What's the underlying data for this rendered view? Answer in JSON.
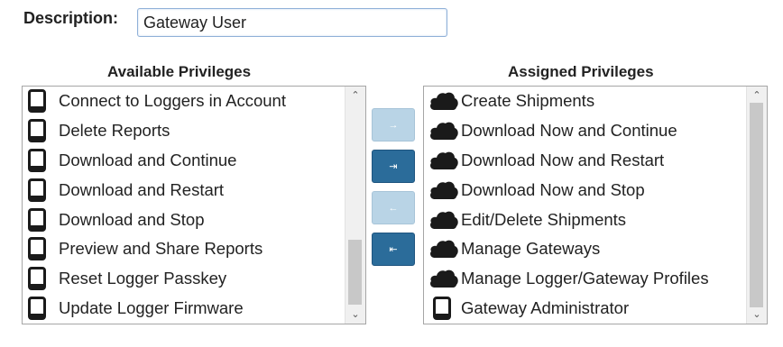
{
  "description": {
    "label": "Description:",
    "value": "Gateway User"
  },
  "available": {
    "title": "Available Privileges",
    "items": [
      {
        "label": "Connect to Loggers in Account",
        "icon": "device-icon"
      },
      {
        "label": "Delete Reports",
        "icon": "device-icon"
      },
      {
        "label": "Download and Continue",
        "icon": "device-icon"
      },
      {
        "label": "Download and Restart",
        "icon": "device-icon"
      },
      {
        "label": "Download and Stop",
        "icon": "device-icon"
      },
      {
        "label": "Preview and Share Reports",
        "icon": "device-icon"
      },
      {
        "label": "Reset Logger Passkey",
        "icon": "device-icon"
      },
      {
        "label": "Update Logger Firmware",
        "icon": "device-icon"
      }
    ],
    "scroll": {
      "up": "⌃",
      "down": "⌄"
    }
  },
  "assigned": {
    "title": "Assigned Privileges",
    "items": [
      {
        "label": "Create Shipments",
        "icon": "cloud-icon"
      },
      {
        "label": "Download Now and Continue",
        "icon": "cloud-icon"
      },
      {
        "label": "Download Now and Restart",
        "icon": "cloud-icon"
      },
      {
        "label": "Download Now and Stop",
        "icon": "cloud-icon"
      },
      {
        "label": "Edit/Delete Shipments",
        "icon": "cloud-icon"
      },
      {
        "label": "Manage Gateways",
        "icon": "cloud-icon"
      },
      {
        "label": "Manage Logger/Gateway Profiles",
        "icon": "cloud-icon"
      },
      {
        "label": "Gateway Administrator",
        "icon": "device-icon"
      }
    ],
    "scroll": {
      "up": "⌃",
      "down": "⌄"
    }
  },
  "buttons": {
    "move_right": {
      "glyph": "→",
      "enabled": false
    },
    "move_all_right": {
      "glyph": "⇥",
      "enabled": true
    },
    "move_left": {
      "glyph": "←",
      "enabled": false
    },
    "move_all_left": {
      "glyph": "⇤",
      "enabled": true
    }
  },
  "colors": {
    "active_button": "#2b6c9a",
    "disabled_button": "#b9d4e6",
    "input_border": "#8fb0d8"
  }
}
